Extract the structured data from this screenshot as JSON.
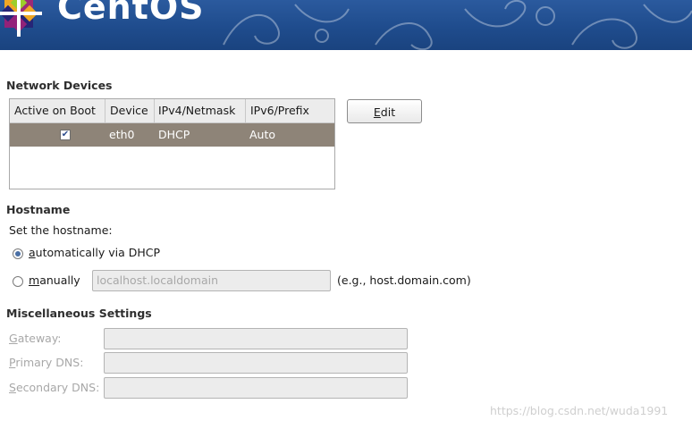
{
  "banner": {
    "brand": "CentOS"
  },
  "network": {
    "section_title": "Network Devices",
    "columns": [
      "Active on Boot",
      "Device",
      "IPv4/Netmask",
      "IPv6/Prefix"
    ],
    "rows": [
      {
        "active": true,
        "device": "eth0",
        "ipv4": "DHCP",
        "ipv6": "Auto"
      }
    ],
    "edit_button": {
      "mnemonic": "E",
      "rest": "dit"
    }
  },
  "hostname": {
    "section_title": "Hostname",
    "prompt": "Set the hostname:",
    "auto_option": {
      "mnemonic": "a",
      "rest": "utomatically via DHCP",
      "selected": true
    },
    "manual_option": {
      "mnemonic": "m",
      "rest": "anually",
      "selected": false
    },
    "manual_value": "localhost.localdomain",
    "example": "(e.g., host.domain.com)"
  },
  "misc": {
    "section_title": "Miscellaneous Settings",
    "gateway": {
      "mnemonic": "G",
      "rest": "ateway:",
      "value": ""
    },
    "primary_dns": {
      "mnemonic": "P",
      "rest": "rimary DNS:",
      "value": ""
    },
    "secondary_dns": {
      "mnemonic": "S",
      "rest": "econdary DNS:",
      "value": ""
    }
  },
  "watermark": "https://blog.csdn.net/wuda1991",
  "colors": {
    "banner": "#1f4c8d",
    "selected_row": "#8e8478",
    "disabled_text": "#a8a8a8",
    "radio_dot": "#4a6fa5"
  }
}
